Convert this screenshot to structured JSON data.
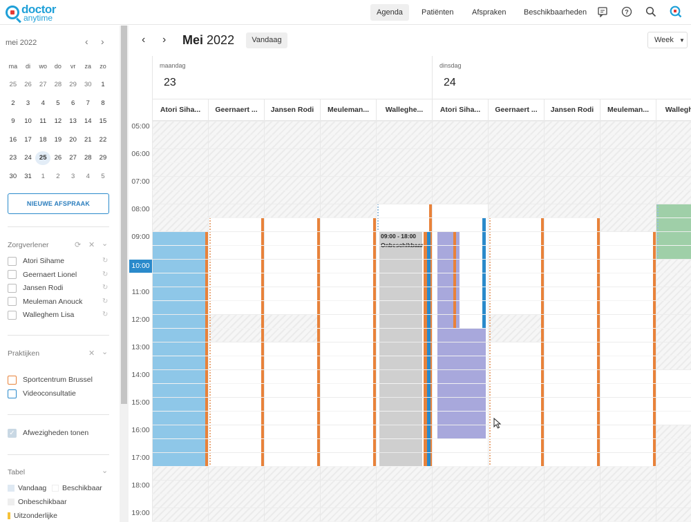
{
  "app": {
    "logo_line1": "doctor",
    "logo_line2": "anytime"
  },
  "nav": {
    "agenda": "Agenda",
    "patienten": "Patiënten",
    "afspraken": "Afspraken",
    "beschikbaarheden": "Beschikbaarheden"
  },
  "mini_calendar": {
    "title": "mei 2022",
    "weekdays": [
      "ma",
      "di",
      "wo",
      "do",
      "vr",
      "za",
      "zo"
    ],
    "weeks": [
      [
        "25",
        "26",
        "27",
        "28",
        "29",
        "30",
        "1"
      ],
      [
        "2",
        "3",
        "4",
        "5",
        "6",
        "7",
        "8"
      ],
      [
        "9",
        "10",
        "11",
        "12",
        "13",
        "14",
        "15"
      ],
      [
        "16",
        "17",
        "18",
        "19",
        "20",
        "21",
        "22"
      ],
      [
        "23",
        "24",
        "25",
        "26",
        "27",
        "28",
        "29"
      ],
      [
        "30",
        "31",
        "1",
        "2",
        "3",
        "4",
        "5"
      ]
    ],
    "today": "25"
  },
  "new_button": "NIEUWE AFSPRAAK",
  "zorgverlener": {
    "title": "Zorgverlener",
    "items": [
      "Atori Sihame",
      "Geernaert Lionel",
      "Jansen Rodi",
      "Meuleman Anouck",
      "Walleghem Lisa"
    ]
  },
  "praktijken": {
    "title": "Praktijken",
    "items": [
      "Sportcentrum Brussel",
      "Videoconsultatie"
    ]
  },
  "absences": "Afwezigheden tonen",
  "tabel": {
    "title": "Tabel",
    "vandaag": "Vandaag",
    "beschikbaar": "Beschikbaar",
    "onbeschikbaar": "Onbeschikbaar",
    "uitzonderlijke": "Uitzonderlijke"
  },
  "header": {
    "month": "Mei",
    "year": "2022",
    "today_button": "Vandaag",
    "view": "Week"
  },
  "days": [
    {
      "name": "maandag",
      "num": "23"
    },
    {
      "name": "dinsdag",
      "num": "24"
    }
  ],
  "columns": [
    "Atori Siha...",
    "Geernaert ...",
    "Jansen Rodi",
    "Meuleman...",
    "Walleghe...",
    "Atori Siha...",
    "Geernaert ...",
    "Jansen Rodi",
    "Meuleman...",
    "Walleghe..."
  ],
  "hours": [
    "05:00",
    "06:00",
    "07:00",
    "08:00",
    "09:00",
    "10:00",
    "11:00",
    "12:00",
    "13:00",
    "14:00",
    "15:00",
    "16:00",
    "17:00",
    "18:00",
    "19:00"
  ],
  "current_hour": "10:00",
  "event": {
    "time": "09:00 - 18:00",
    "label": "Onbeschikbaar"
  },
  "colors": {
    "accent": "#2a8acb",
    "orange": "#e8823a",
    "event_blue": "#8ec7e8",
    "event_purple": "#a8a8dc",
    "event_green": "#9fcfa8",
    "event_gray": "#cfcfcf"
  }
}
